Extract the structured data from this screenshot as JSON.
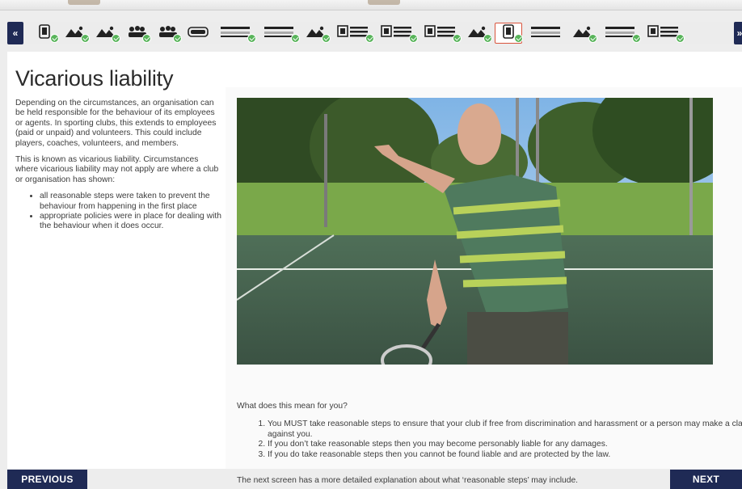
{
  "nav": {
    "prev_arrow": "«",
    "next_arrow": "»",
    "slides": [
      {
        "icon": "document",
        "done": true,
        "active": false
      },
      {
        "icon": "image",
        "done": true,
        "active": false
      },
      {
        "icon": "image",
        "done": true,
        "active": false
      },
      {
        "icon": "people",
        "done": true,
        "active": false
      },
      {
        "icon": "people",
        "done": true,
        "active": false
      },
      {
        "icon": "button",
        "done": false,
        "active": false
      },
      {
        "icon": "slider",
        "done": true,
        "active": false
      },
      {
        "icon": "slider",
        "done": true,
        "active": false
      },
      {
        "icon": "image",
        "done": true,
        "active": false
      },
      {
        "icon": "text-list",
        "done": true,
        "active": false
      },
      {
        "icon": "text-list",
        "done": true,
        "active": false
      },
      {
        "icon": "text-list",
        "done": true,
        "active": false
      },
      {
        "icon": "image",
        "done": true,
        "active": false
      },
      {
        "icon": "document",
        "done": true,
        "active": true
      },
      {
        "icon": "slider",
        "done": false,
        "active": false
      },
      {
        "icon": "image",
        "done": true,
        "active": false
      },
      {
        "icon": "slider",
        "done": true,
        "active": false
      },
      {
        "icon": "text-list",
        "done": true,
        "active": false
      }
    ]
  },
  "content": {
    "title": "Vicarious liability",
    "para1": "Depending on the circumstances, an organisation can be held responsible for the behaviour of its employees or agents. In sporting clubs, this extends to employees (paid or unpaid) and volunteers. This could include players, coaches, volunteers, and members.",
    "para2": "This is known as vicarious liability. Circumstances where vicarious liability may not apply are where a club or organisation has shown:",
    "bullets": [
      "all reasonable steps were taken to prevent the behaviour from happening in the first place",
      "appropriate policies were in place for dealing with the behaviour when it does occur."
    ],
    "question": "What does this mean for you?",
    "steps": [
      "You MUST take reasonable steps to ensure that your club if free from discrimination and harassment or a person may make a claim against you.",
      "If you don’t take reasonable steps then you may become personably liable for any damages.",
      "If you do take reasonable steps then you cannot be found liable and are protected by the law."
    ],
    "footnote": "The next screen has a more detailed explanation about what ‘reasonable steps’ may include."
  },
  "buttons": {
    "previous": "PREVIOUS",
    "next": "NEXT"
  },
  "colors": {
    "nav_dark": "#1f2a55",
    "active_border": "#d9533c",
    "check_green": "#58b45a"
  }
}
